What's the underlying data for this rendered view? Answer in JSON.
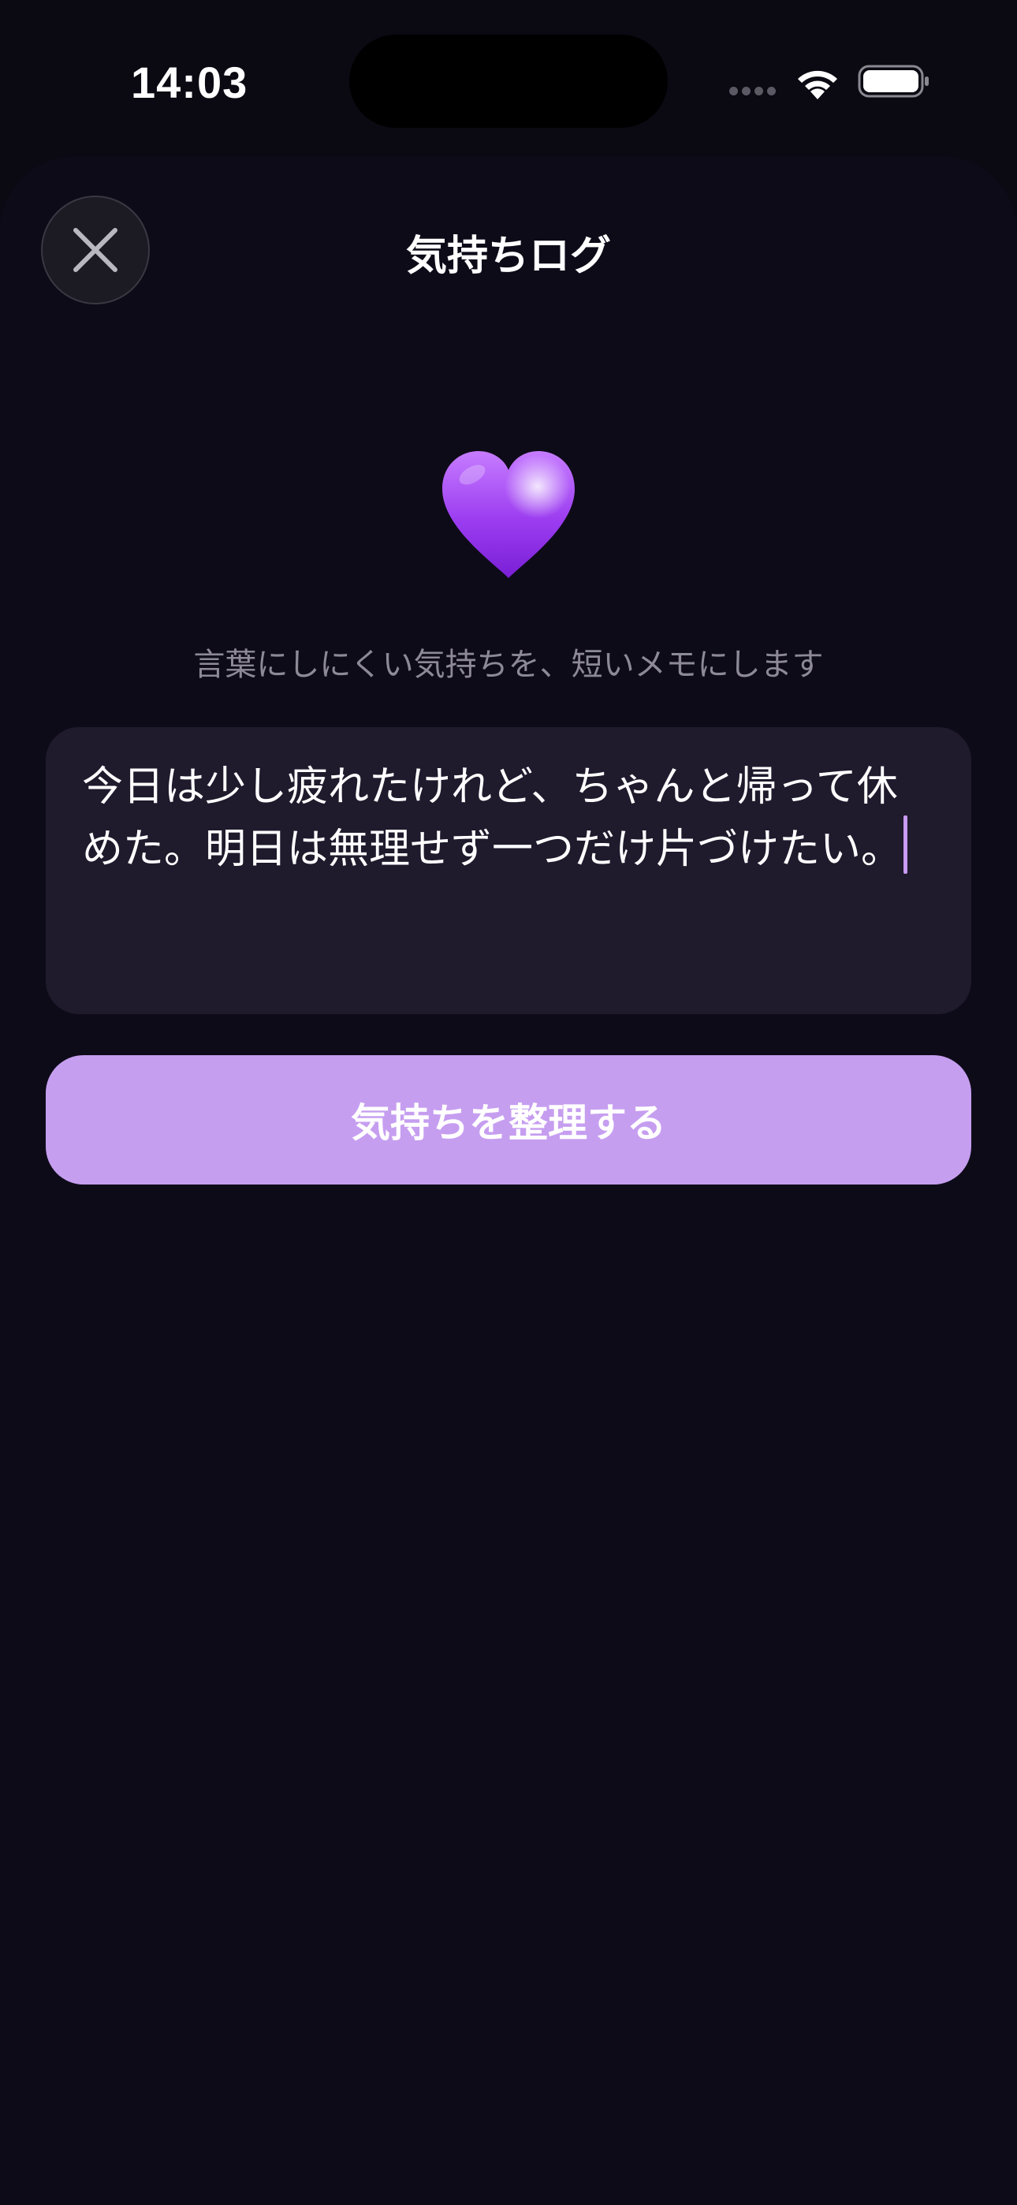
{
  "status_bar": {
    "time": "14:03",
    "icons": [
      "signal-icon",
      "wifi-icon",
      "battery-icon"
    ]
  },
  "sheet": {
    "title": "気持ちログ",
    "close_icon": "close-icon",
    "hero_icon": "purple-heart-icon",
    "subtitle": "言葉にしにくい気持ちを、短いメモにします",
    "memo": {
      "value": "今日は少し疲れたけれど、ちゃんと帰って休めた。明日は無理せず一つだけ片づけたい。"
    },
    "primary_button_label": "気持ちを整理する"
  },
  "colors": {
    "background": "#0b0912",
    "sheet_background": "#0e0b19",
    "field_background": "#1f1a2c",
    "accent": "#c69ef0",
    "caret": "#c89af0",
    "heart": "#9b3cf0"
  }
}
